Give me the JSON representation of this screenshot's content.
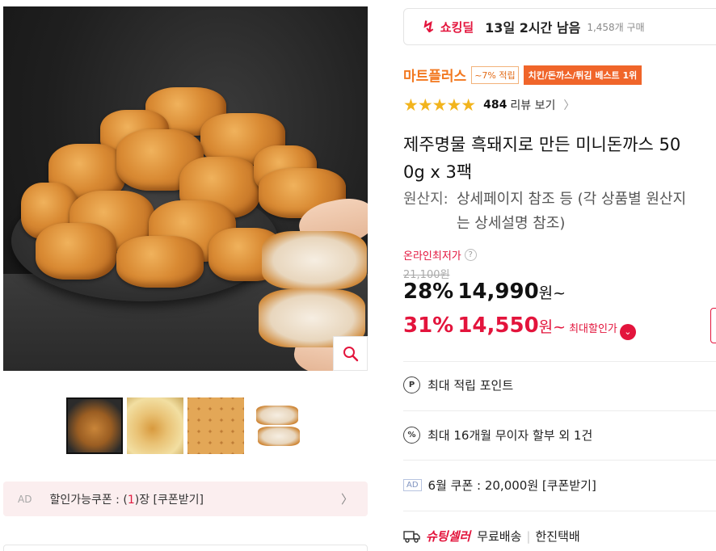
{
  "deal": {
    "title": "쇼킹딜",
    "time_left": "13일 2시간 남음",
    "purchases": "1,458개 구매"
  },
  "badges": {
    "mart": "마트플러스",
    "reward": "~7% 적립",
    "best": "치킨/돈까스/튀김 베스트 1위"
  },
  "rating": {
    "stars": "★★★★★",
    "value": 4.5,
    "count": "484",
    "label": "리뷰 보기",
    "chevron": "〉"
  },
  "product": {
    "title_line1": "제주명물 흑돼지로 만든 미니돈까스 50",
    "title_line2": "0g x 3팩",
    "origin_key": "원산지:",
    "origin_line1": "상세페이지 참조 등 (각 상품별 원산지",
    "origin_line2": "는 상세설명 참조)"
  },
  "price": {
    "lowest_label": "온라인최저가",
    "help": "?",
    "original": "21,100원",
    "discount1_pct": "28%",
    "discount1_amount": "14,990",
    "discount1_suffix": "원~",
    "discount2_pct": "31%",
    "discount2_amount": "14,550",
    "discount2_suffix": "원~",
    "max_label": "최대할인가",
    "expand": "⌄"
  },
  "info": {
    "points_icon": "P",
    "points": "최대 적립 포인트",
    "installment_icon": "%",
    "installment": "최대 16개월 무이자 할부 외 1건",
    "ad_tag": "AD",
    "coupon": "6월 쿠폰 : 20,000원 [쿠폰받기]",
    "seller": "슈팅셀러",
    "shipping": "무료배송",
    "carrier": "한진택배"
  },
  "left_coupon": {
    "ad": "AD",
    "label_prefix": "할인가능쿠폰 : (",
    "count": "1",
    "label_suffix": ")장 [쿠폰받기]",
    "arrow": "〉"
  },
  "icons": {
    "zoom": "magnifier-icon",
    "deal": "lightning-icon",
    "truck": "truck-icon"
  },
  "colors": {
    "accent_red": "#e3143c",
    "mart_orange": "#f2781f",
    "star": "#f2b41d"
  }
}
